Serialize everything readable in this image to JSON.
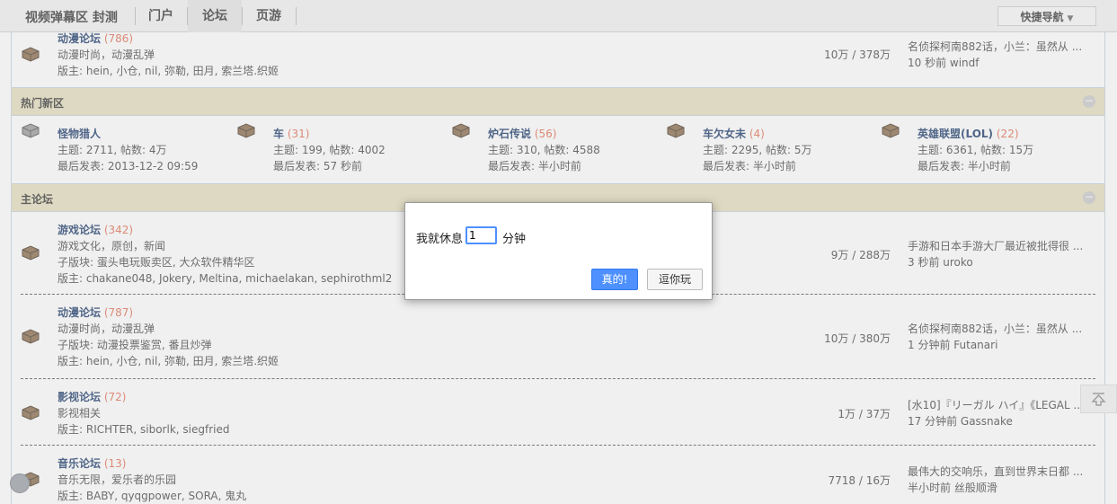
{
  "topnav": {
    "brand": "视频弹幕区 封测",
    "items": [
      "门户",
      "论坛",
      "页游"
    ],
    "quick_nav": "快捷导航"
  },
  "top_forum": {
    "name": "动漫论坛",
    "count": "(786)",
    "desc": "动漫时尚，动漫乱弹",
    "mods": "版主: hein, 小仓, nil, 弥勒, 田月, 索兰塔.织姬",
    "stats": "10万 / 378万",
    "last_title": "名侦探柯南882话，小兰：虽然从 ...",
    "last_meta": "10 秒前 windf"
  },
  "hot_section": {
    "title": "热门新区",
    "toggle": "−",
    "items": [
      {
        "name": "怪物猎人",
        "count": "",
        "topics": "主题: 2711, 帖数: 4万",
        "last": "最后发表: 2013-12-2 09:59"
      },
      {
        "name": "车",
        "count": "(31)",
        "topics": "主题: 199, 帖数: 4002",
        "last": "最后发表: 57 秒前"
      },
      {
        "name": "炉石传说",
        "count": "(56)",
        "topics": "主题: 310, 帖数: 4588",
        "last": "最后发表: 半小时前"
      },
      {
        "name": "车欠女未",
        "count": "(4)",
        "topics": "主题: 2295, 帖数: 5万",
        "last": "最后发表: 半小时前"
      },
      {
        "name": "英雄联盟(LOL)",
        "count": "(22)",
        "topics": "主题: 6361, 帖数: 15万",
        "last": "最后发表: 半小时前"
      }
    ]
  },
  "main_section": {
    "title": "主论坛",
    "toggle": "−",
    "forums": [
      {
        "name": "游戏论坛",
        "count": "(342)",
        "desc": "游戏文化，原创，新闻",
        "sub": "子版块: 蛋头电玩贩卖区, 大众软件精华区",
        "mods": "版主: chakane048, Jokery, Meltina, michaelakan, sephirothml2",
        "stats": "9万 / 288万",
        "last_title": "手游和日本手游大厂最近被批得很 ...",
        "last_meta": "3 秒前 uroko"
      },
      {
        "name": "动漫论坛",
        "count": "(787)",
        "desc": "动漫时尚，动漫乱弹",
        "sub": "子版块: 动漫投票鉴赏, 番且炒弹",
        "mods": "版主: hein, 小仓, nil, 弥勒, 田月, 索兰塔.织姬",
        "stats": "10万 / 380万",
        "last_title": "名侦探柯南882话，小兰：虽然从 ...",
        "last_meta": "1 分钟前 Futanari"
      },
      {
        "name": "影视论坛",
        "count": "(72)",
        "desc": "影视相关",
        "sub": "",
        "mods": "版主: RICHTER, siborlk, siegfried",
        "stats": "1万 / 37万",
        "last_title": "[水10]『リーガル ハイ』《LEGAL ...",
        "last_meta": "17 分钟前 Gassnake"
      },
      {
        "name": "音乐论坛",
        "count": "(13)",
        "desc": "音乐无限，爱乐者的乐园",
        "sub": "",
        "mods": "版主: BABY, qyqgpower, SORA, 鬼丸",
        "stats": "7718 / 16万",
        "last_title": "最伟大的交响乐，直到世界末日都 ...",
        "last_meta": "半小时前 丝般顺滑"
      }
    ]
  },
  "dialog": {
    "message": "我就休息",
    "input_value": "1",
    "unit": "分钟",
    "ok_label": "真的!",
    "cancel_label": "逗你玩"
  },
  "icons": {
    "forum": "box-icon",
    "back_top": "back-to-top-icon",
    "power": "power-icon"
  },
  "colors": {
    "section_bg": "#e6dfbd",
    "forum_name": "#1b3a6b",
    "count": "#e26d52",
    "primary_button": "#4d90fe"
  }
}
